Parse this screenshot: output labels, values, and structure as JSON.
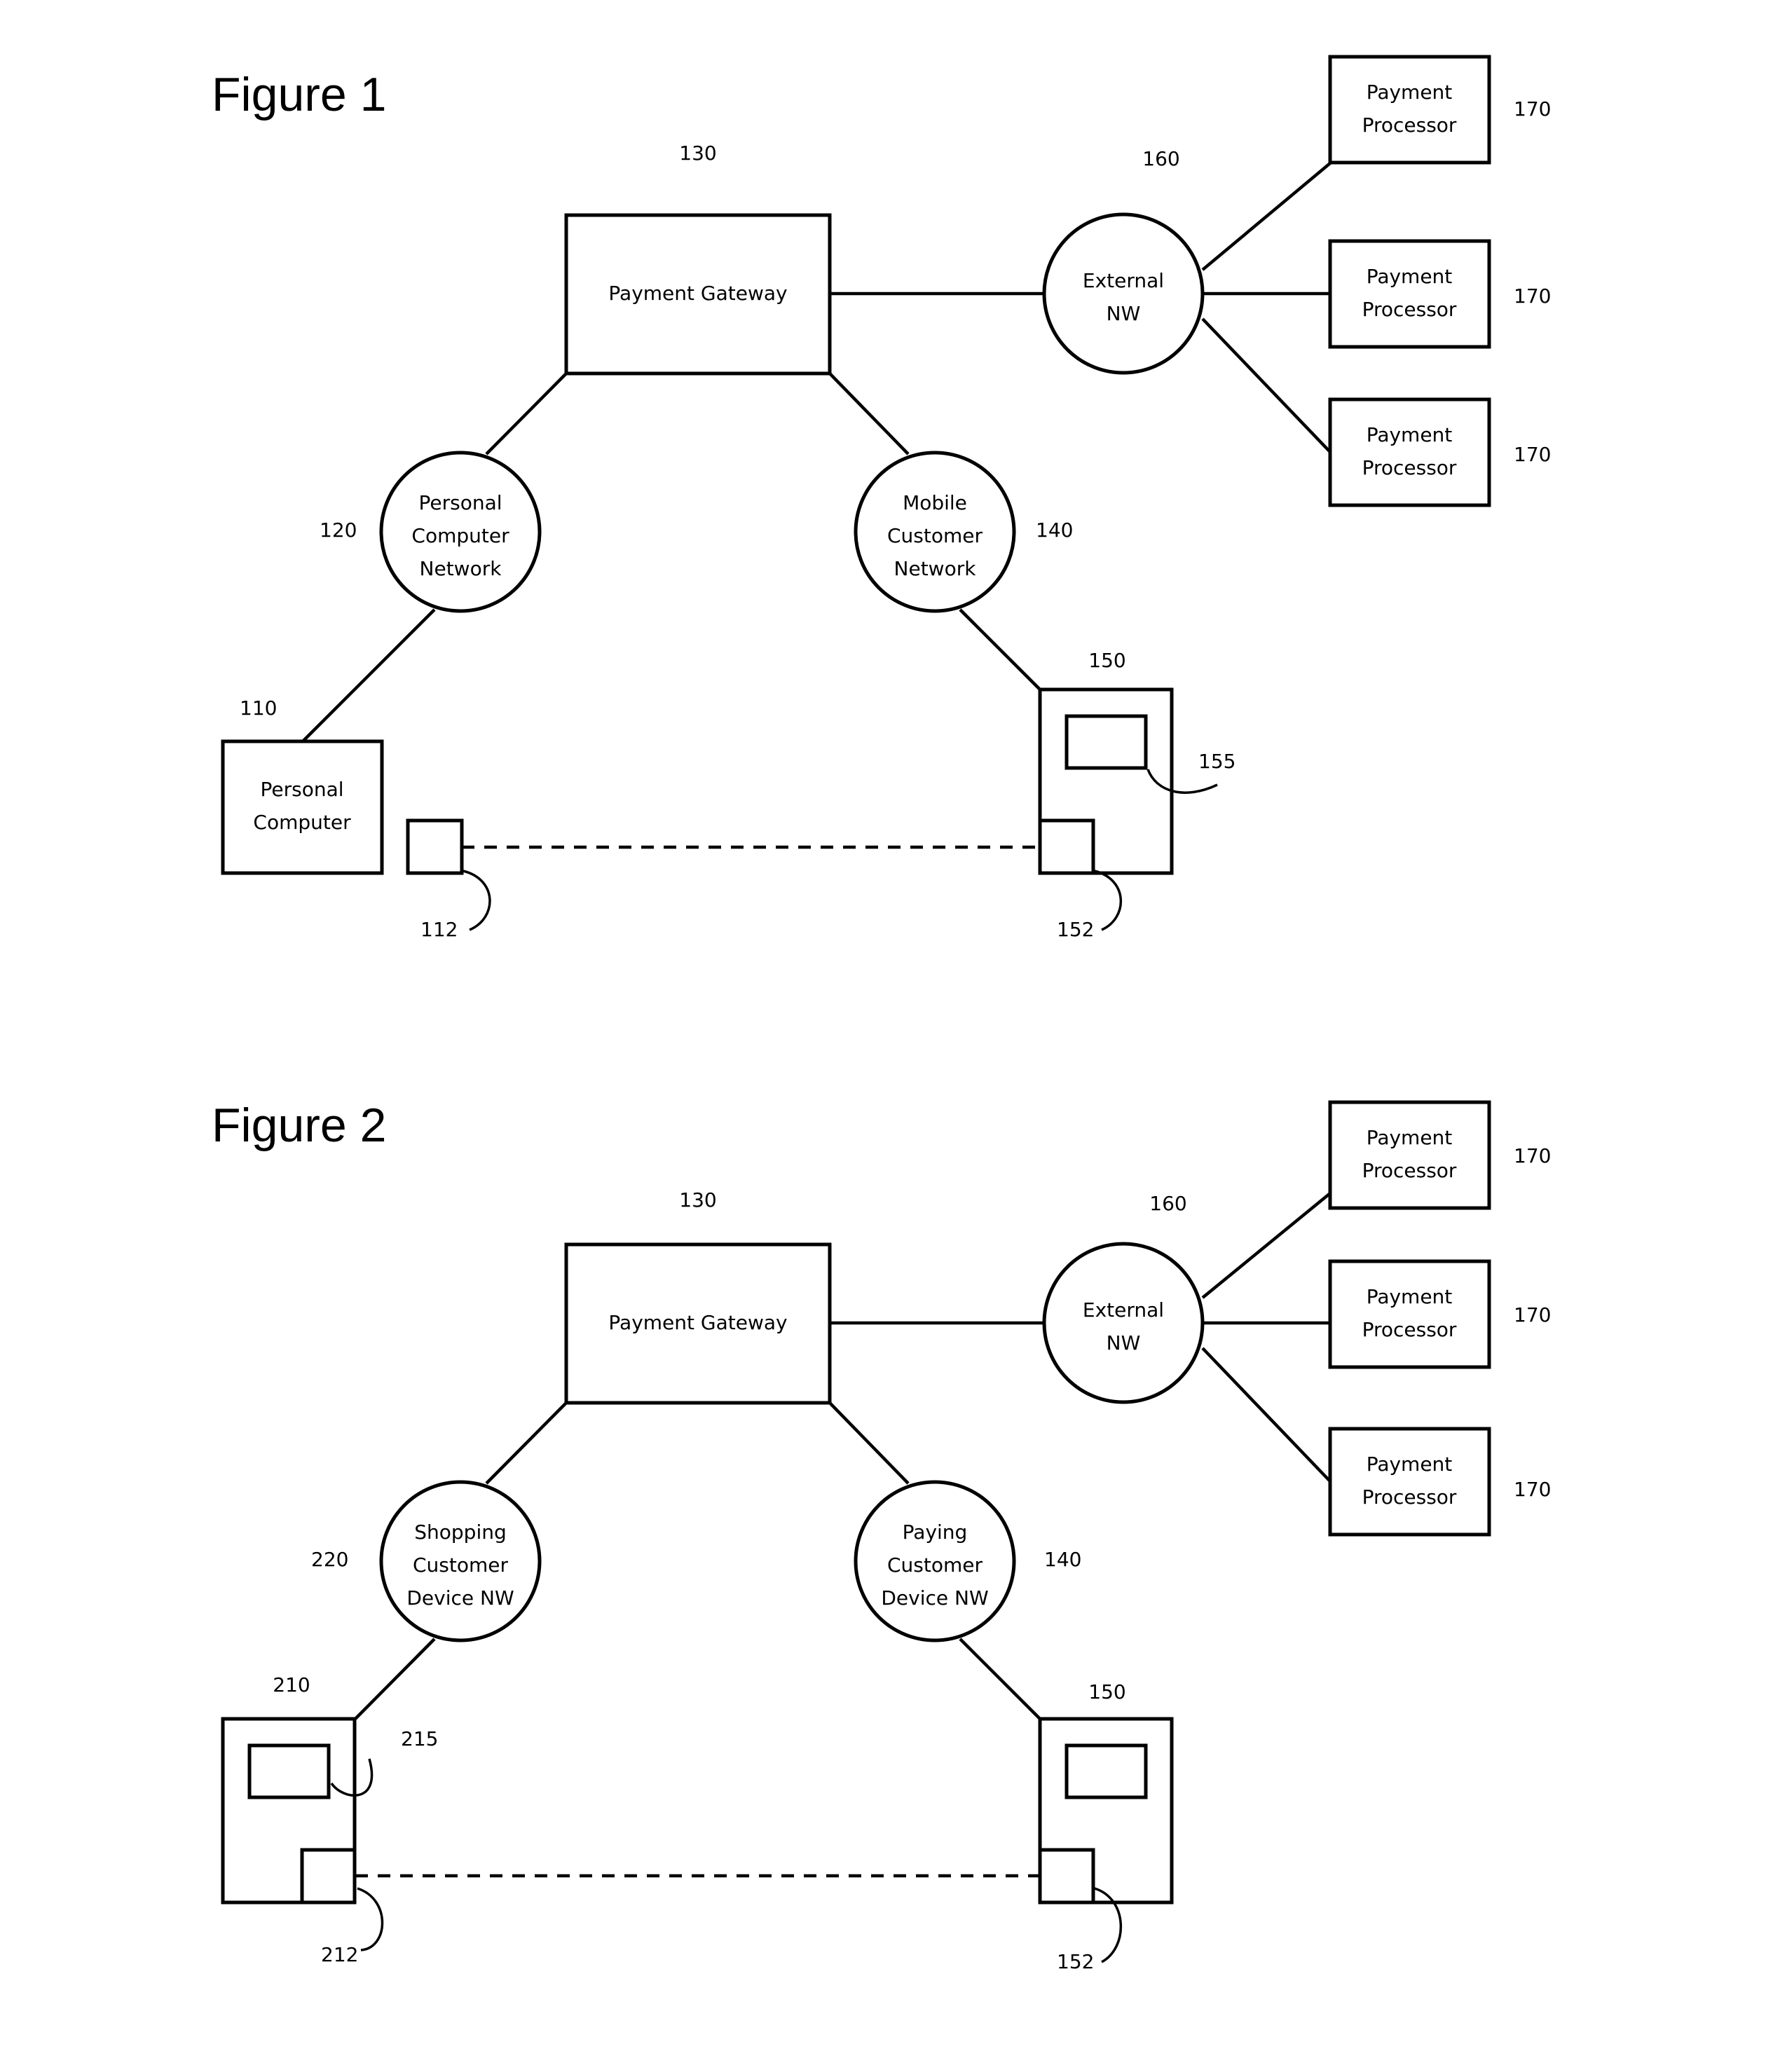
{
  "figures": [
    {
      "title": "Figure 1",
      "payment_gateway": {
        "label": "Payment Gateway",
        "ref": "130"
      },
      "external_nw": {
        "lines": [
          "External",
          "NW"
        ],
        "ref": "160"
      },
      "payment_processors": [
        {
          "lines": [
            "Payment",
            "Processor"
          ],
          "ref": "170"
        },
        {
          "lines": [
            "Payment",
            "Processor"
          ],
          "ref": "170"
        },
        {
          "lines": [
            "Payment",
            "Processor"
          ],
          "ref": "170"
        }
      ],
      "left_network": {
        "lines": [
          "Personal",
          "Computer",
          "Network"
        ],
        "ref": "120"
      },
      "right_network": {
        "lines": [
          "Mobile",
          "Customer",
          "Network"
        ],
        "ref": "140"
      },
      "left_device": {
        "lines": [
          "Personal",
          "Computer"
        ],
        "ref": "110",
        "module_ref": "112"
      },
      "right_device": {
        "ref": "150",
        "module_ref": "152",
        "screen_ref": "155"
      }
    },
    {
      "title": "Figure 2",
      "payment_gateway": {
        "label": "Payment Gateway",
        "ref": "130"
      },
      "external_nw": {
        "lines": [
          "External",
          "NW"
        ],
        "ref": "160"
      },
      "payment_processors": [
        {
          "lines": [
            "Payment",
            "Processor"
          ],
          "ref": "170"
        },
        {
          "lines": [
            "Payment",
            "Processor"
          ],
          "ref": "170"
        },
        {
          "lines": [
            "Payment",
            "Processor"
          ],
          "ref": "170"
        }
      ],
      "left_network": {
        "lines": [
          "Shopping",
          "Customer",
          "Device NW"
        ],
        "ref": "220"
      },
      "right_network": {
        "lines": [
          "Paying",
          "Customer",
          "Device NW"
        ],
        "ref": "140"
      },
      "left_device": {
        "ref": "210",
        "module_ref": "212",
        "screen_ref": "215"
      },
      "right_device": {
        "ref": "150",
        "module_ref": "152"
      }
    }
  ]
}
